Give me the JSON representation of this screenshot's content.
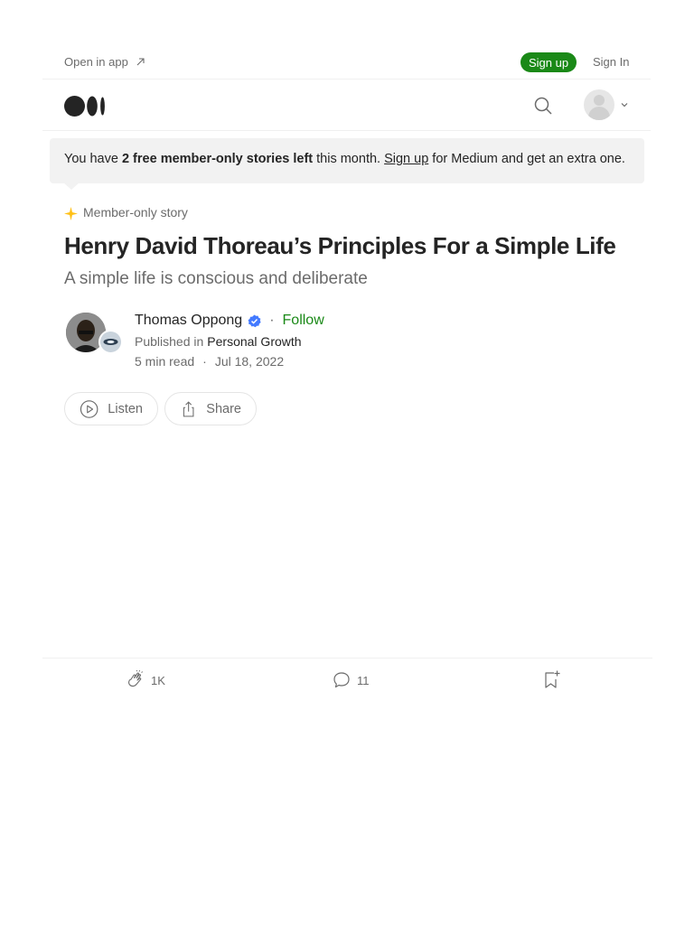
{
  "topbar": {
    "open_in_app": "Open in app",
    "sign_up": "Sign up",
    "sign_in": "Sign In"
  },
  "banner": {
    "part1": "You have ",
    "bold": "2 free member-only stories left",
    "part2": " this month. ",
    "link": "Sign up",
    "part3": " for Medium and get an extra one."
  },
  "article": {
    "member_label": "Member-only story",
    "title": "Henry David Thoreau’s Principles For a Simple Life",
    "subtitle": "A simple life is conscious and deliberate",
    "author": "Thomas Oppong",
    "follow": "Follow",
    "published_in_label": "Published in",
    "publication": "Personal Growth",
    "read_time": "5 min read",
    "separator": "·",
    "date": "Jul 18, 2022"
  },
  "actions": {
    "listen": "Listen",
    "share": "Share"
  },
  "footer": {
    "claps": "1K",
    "responses": "11"
  },
  "colors": {
    "accent_green": "#1a8917",
    "banner_bg": "#f2f2f2",
    "star_gold": "#ffc017",
    "verified_blue": "#437aff"
  },
  "icons": [
    "external-link-icon",
    "medium-logo",
    "search-icon",
    "user-avatar-icon",
    "chevron-down-icon",
    "star-icon",
    "verified-badge-icon",
    "play-icon",
    "share-icon",
    "clap-icon",
    "comment-icon",
    "bookmark-add-icon"
  ]
}
